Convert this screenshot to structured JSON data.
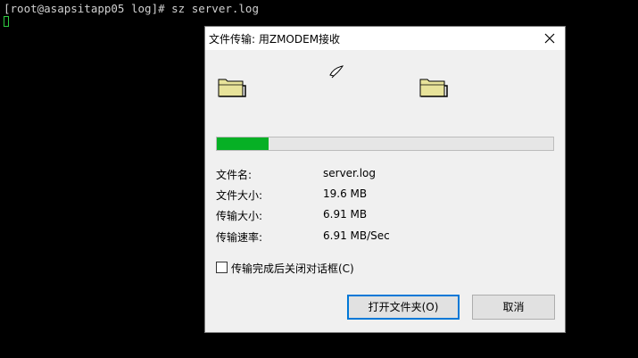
{
  "terminal": {
    "prompt_line": "[root@asapsitapp05 log]# sz server.log"
  },
  "dialog": {
    "title": "文件传输: 用ZMODEM接收",
    "progress": 0.155,
    "info": [
      {
        "label": "文件名:",
        "value": "server.log"
      },
      {
        "label": "文件大小:",
        "value": "19.6 MB"
      },
      {
        "label": "传输大小:",
        "value": "6.91 MB"
      },
      {
        "label": "传输速率:",
        "value": "6.91 MB/Sec"
      }
    ],
    "close_when_done_label": "传输完成后关闭对话框(C)",
    "close_when_done_checked": false,
    "open_folder_label": "打开文件夹(O)",
    "cancel_label": "取消"
  },
  "colors": {
    "progress_fill": "#06b025",
    "terminal_cursor": "#2ecc40",
    "focus_border": "#0078d7"
  },
  "icons": [
    "folder-icon",
    "paper-flying-icon",
    "folder-icon",
    "close-icon"
  ]
}
